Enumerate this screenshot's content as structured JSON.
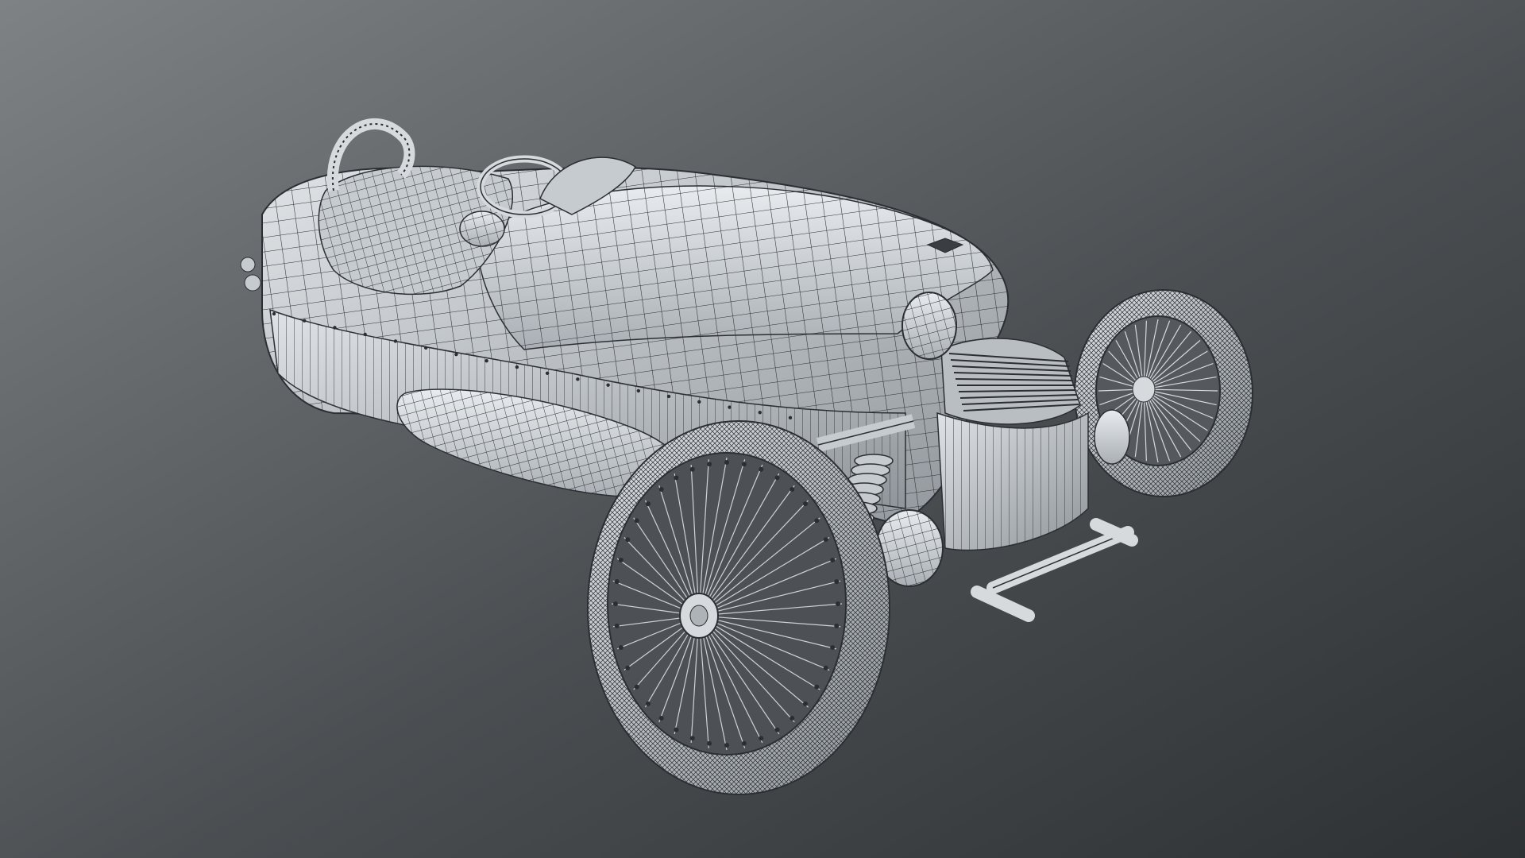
{
  "viewport": {
    "background_top_left": "#7f8284",
    "background_bottom_right": "#2e3133",
    "background_mid": "#4b4f52"
  },
  "model": {
    "subject": "three-wheeler-roadster",
    "render_mode": "wireframe-on-shaded",
    "shade_color": "#d6dadd",
    "shade_dark": "#9aa0a5",
    "wire_color": "#2b2f33",
    "emblem_icon": "winged-badge-icon"
  }
}
